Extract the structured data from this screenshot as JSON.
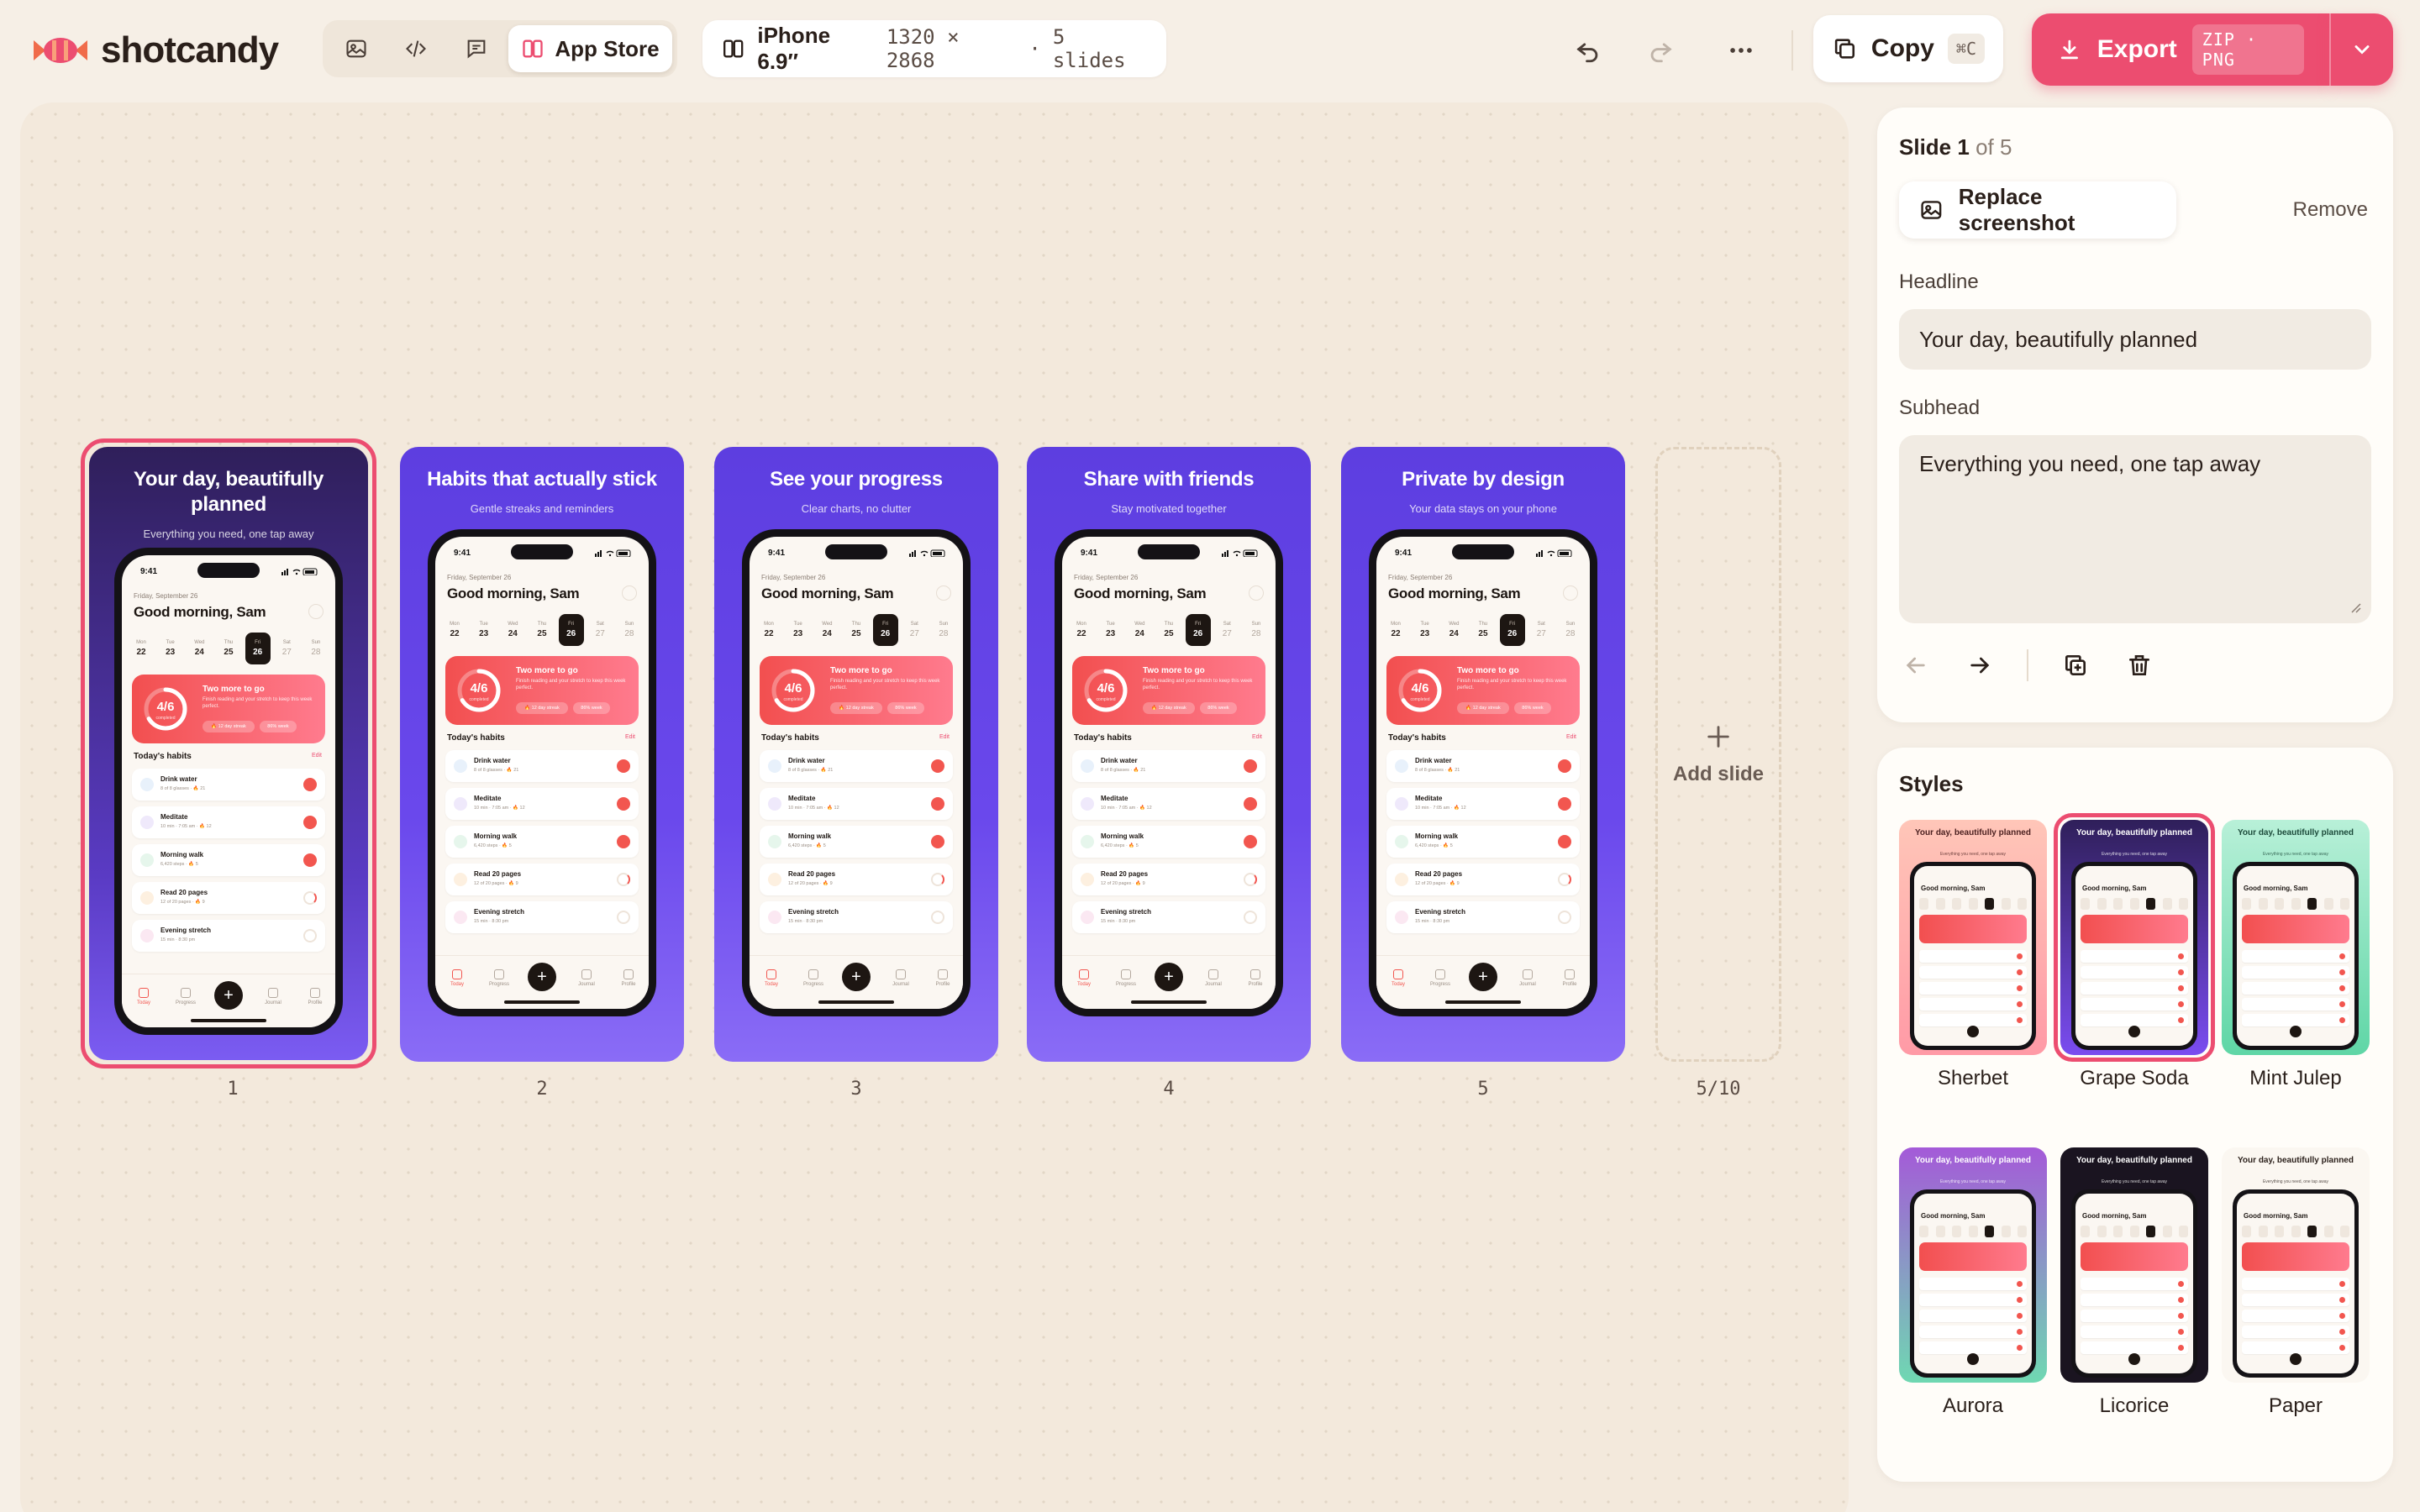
{
  "app": {
    "name": "shotcandy"
  },
  "toolbar": {
    "mode_active_label": "App Store",
    "device_name": "iPhone 6.9″",
    "device_dims": "1320 × 2868",
    "device_sep": "·",
    "slide_count_label": "5 slides",
    "copy_label": "Copy",
    "copy_shortcut": "⌘C",
    "export_label": "Export",
    "export_formats": "ZIP · PNG"
  },
  "slides": [
    {
      "number": "1",
      "headline": "Your day, beautifully planned",
      "subhead": "Everything you need, one tap away"
    },
    {
      "number": "2",
      "headline": "Habits that actually stick",
      "subhead": "Gentle streaks and reminders"
    },
    {
      "number": "3",
      "headline": "See your progress",
      "subhead": "Clear charts, no clutter"
    },
    {
      "number": "4",
      "headline": "Share with friends",
      "subhead": "Stay motivated together"
    },
    {
      "number": "5",
      "headline": "Private by design",
      "subhead": "Your data stays on your phone"
    }
  ],
  "add_slide": {
    "label": "Add slide",
    "count": "5/10"
  },
  "phone": {
    "time": "9:41",
    "date": "Friday, September 26",
    "greeting": "Good morning, Sam",
    "week": [
      {
        "label": "Mon",
        "day": "22"
      },
      {
        "label": "Tue",
        "day": "23"
      },
      {
        "label": "Wed",
        "day": "24"
      },
      {
        "label": "Thu",
        "day": "25"
      },
      {
        "label": "Fri",
        "day": "26"
      },
      {
        "label": "Sat",
        "day": "27"
      },
      {
        "label": "Sun",
        "day": "28"
      }
    ],
    "progress": {
      "ring_label": "4/6",
      "ring_sub": "completed",
      "title": "Two more to go",
      "desc": "Finish reading and your stretch to keep this week perfect.",
      "pill_streak": "🔥 12 day streak",
      "pill_week": "86% week"
    },
    "habits_title": "Today's habits",
    "habits_edit": "Edit",
    "habits": [
      {
        "name": "Drink water",
        "meta": "8 of 8 glasses  · 🔥 21",
        "color": "#e8f1fb",
        "state": "done"
      },
      {
        "name": "Meditate",
        "meta": "10 min · 7:05 am  · 🔥 12",
        "color": "#efe9fb",
        "state": "done"
      },
      {
        "name": "Morning walk",
        "meta": "6,420 steps  · 🔥 5",
        "color": "#e6f6ec",
        "state": "done"
      },
      {
        "name": "Read 20 pages",
        "meta": "12 of 20 pages  · 🔥 9",
        "color": "#fdf0e0",
        "state": "part"
      },
      {
        "name": "Evening stretch",
        "meta": "15 min · 8:30 pm",
        "color": "#fbe8f2",
        "state": "none"
      }
    ],
    "tabs": [
      "Today",
      "Progress",
      "",
      "Journal",
      "Profile"
    ]
  },
  "panel": {
    "slide_prefix": "Slide",
    "slide_current": "1",
    "slide_of": "of 5",
    "replace_label": "Replace screenshot",
    "remove_label": "Remove",
    "headline_label": "Headline",
    "headline_value": "Your day, beautifully planned",
    "subhead_label": "Subhead",
    "subhead_value": "Everything you need, one tap away"
  },
  "styles": {
    "title": "Styles",
    "items": [
      {
        "name": "Sherbet",
        "bg": "linear-gradient(180deg,#ffc6b8,#ff9aa6)",
        "text": "#4a1f1f"
      },
      {
        "name": "Grape Soda",
        "bg": "linear-gradient(180deg,#2f1f5a,#7a4cf0)",
        "text": "#ffffff"
      },
      {
        "name": "Mint Julep",
        "bg": "linear-gradient(180deg,#b8f0d8,#5fd6a6)",
        "text": "#1c4a3a"
      },
      {
        "name": "Aurora",
        "bg": "linear-gradient(180deg,#a45ad8,#6fd8b2)",
        "text": "#ffffff"
      },
      {
        "name": "Licorice",
        "bg": "#1a1420",
        "text": "#ffffff"
      },
      {
        "name": "Paper",
        "bg": "#fbf7f1",
        "text": "#2a1f1a"
      }
    ]
  },
  "colors": {
    "accent": "#ec4d70",
    "slide_purple_top": "#3a2878",
    "slide_purple_bottom": "#7b5cf2"
  }
}
